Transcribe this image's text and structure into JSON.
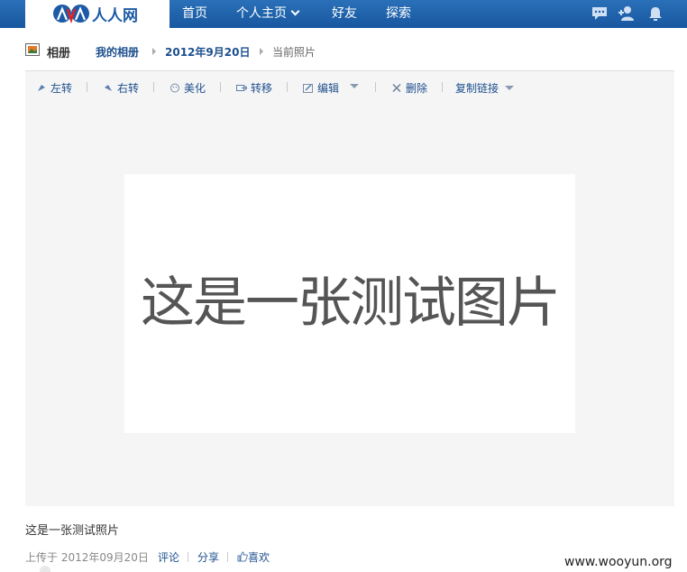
{
  "header": {
    "logo_text": "人人网",
    "nav": {
      "home": "首页",
      "profile": "个人主页",
      "friends": "好友",
      "explore": "探索"
    },
    "icons": [
      "chat-icon",
      "add-friend-icon",
      "notification-bell-icon"
    ]
  },
  "breadcrumb": {
    "section": "相册",
    "my_albums": "我的相册",
    "album": "2012年9月20日",
    "current": "当前照片"
  },
  "toolbar": {
    "rotate_left": "左转",
    "rotate_right": "右转",
    "beautify": "美化",
    "move": "转移",
    "edit": "编辑",
    "delete": "删除",
    "copy_link": "复制链接"
  },
  "photo": {
    "text": "这是一张测试图片"
  },
  "caption": "这是一张测试照片",
  "meta": {
    "uploaded": "上传于 2012年09月20日",
    "comment": "评论",
    "share": "分享",
    "like": "喜欢"
  },
  "watermark": "www.wooyun.org",
  "colors": {
    "nav_bg": "#1a5ea8",
    "link": "#1d4f8f",
    "panel_bg": "#f5f5f5"
  }
}
